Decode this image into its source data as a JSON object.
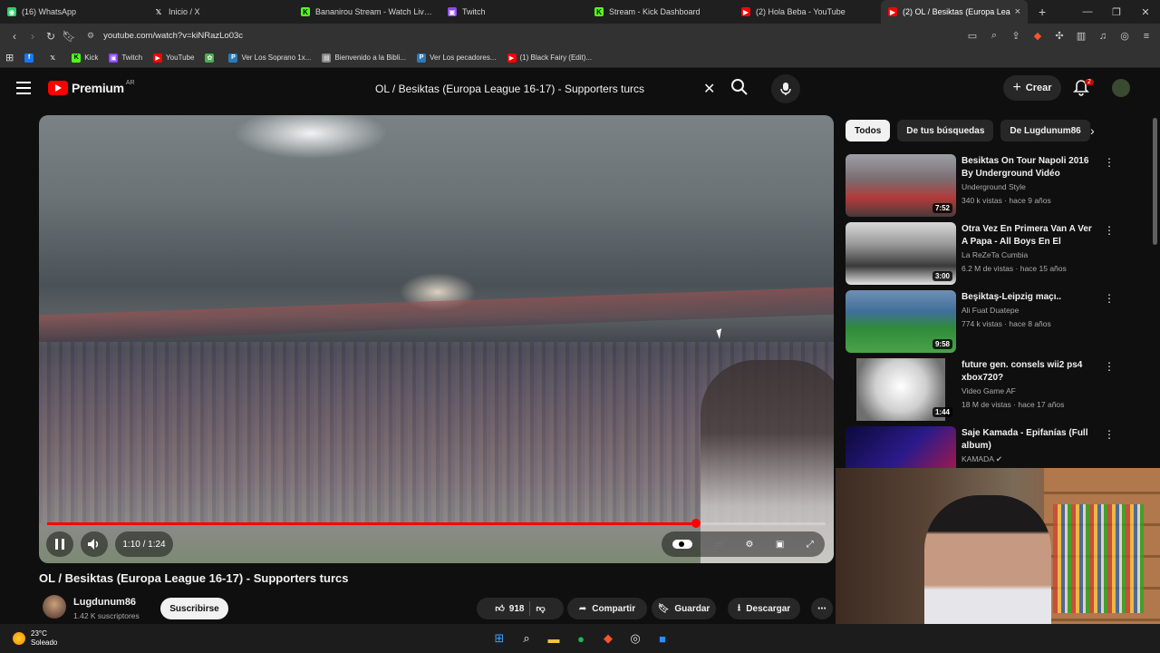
{
  "browser": {
    "tabs": [
      {
        "label": "(16) WhatsApp",
        "color": "#25d366",
        "glyph": "◉"
      },
      {
        "label": "Inicio / X",
        "color": "#000000",
        "glyph": "𝕏"
      },
      {
        "label": "Bananirou Stream - Watch Live on Ki",
        "color": "#53fc18",
        "glyph": "K"
      },
      {
        "label": "Twitch",
        "color": "#9146ff",
        "glyph": "▣"
      },
      {
        "label": "Stream - Kick Dashboard",
        "color": "#53fc18",
        "glyph": "K"
      },
      {
        "label": "(2) Hola Beba - YouTube",
        "color": "#ff0000",
        "glyph": "▶"
      },
      {
        "label": "(2) OL / Besiktas (Europa Lea",
        "color": "#ff0000",
        "glyph": "▶",
        "active": true
      }
    ],
    "url": "youtube.com/watch?v=kiNRazLo03c",
    "bookmarks": [
      {
        "label": "",
        "color": "#1877f2",
        "glyph": "f"
      },
      {
        "label": "",
        "color": "#000000",
        "glyph": "𝕏"
      },
      {
        "label": "Kick",
        "color": "#53fc18",
        "glyph": "K"
      },
      {
        "label": "Twitch",
        "color": "#9146ff",
        "glyph": "▣"
      },
      {
        "label": "YouTube",
        "color": "#ff0000",
        "glyph": "▶"
      },
      {
        "label": "",
        "color": "#4caf50",
        "glyph": "✿"
      },
      {
        "label": "Ver Los Soprano 1x...",
        "color": "#2a7ab8",
        "glyph": "P"
      },
      {
        "label": "Bienvenido a la Bibli...",
        "color": "#888888",
        "glyph": "▤"
      },
      {
        "label": "Ver Los pecadores...",
        "color": "#2a7ab8",
        "glyph": "P"
      },
      {
        "label": "(1) Black Fairy (Edit)...",
        "color": "#ff0000",
        "glyph": "▶"
      }
    ]
  },
  "youtube": {
    "logo_text": "Premium",
    "country_code": "AR",
    "search_query": "OL / Besiktas (Europa League 16-17) - Supporters turcs",
    "create_label": "Crear",
    "notif_count": "2"
  },
  "player": {
    "time_display": "1:10 / 1:24",
    "progress": 0.833
  },
  "video": {
    "title": "OL / Besiktas (Europa League 16-17) - Supporters turcs",
    "channel": "Lugdunum86",
    "subscribers": "1.42 K suscriptores",
    "subscribe_label": "Suscribirse",
    "likes": "918",
    "share_label": "Compartir",
    "save_label": "Guardar",
    "download_label": "Descargar"
  },
  "sidebar": {
    "chips": [
      "Todos",
      "De tus búsquedas",
      "De Lugdunum86"
    ],
    "recommendations": [
      {
        "title": "Besiktas On Tour Napoli 2016 By Underground Vidéo",
        "channel": "Underground Style",
        "meta": "340 k vistas · hace 9 años",
        "duration": "7:52"
      },
      {
        "title": "Otra Vez En Primera Van A Ver A Papa - All Boys En El Bosque...",
        "channel": "La ReZeTa Cumbia",
        "meta": "6.2 M de vistas · hace 15 años",
        "duration": "3:00"
      },
      {
        "title": "Beşiktaş-Leipzig maçı..",
        "channel": "Ali Fuat Duatepe",
        "meta": "774 k vistas · hace 8 años",
        "duration": "9:58"
      },
      {
        "title": "future gen. consels wii2 ps4 xbox720?",
        "channel": "Video Game AF",
        "meta": "18 M de vistas · hace 17 años",
        "duration": "1:44"
      },
      {
        "title": "Saje Kamada - Epifanías (Full album)",
        "channel": "KAMADA",
        "meta": "",
        "duration": ""
      }
    ]
  },
  "taskbar": {
    "temperature": "23°C",
    "weather": "Soleado"
  }
}
